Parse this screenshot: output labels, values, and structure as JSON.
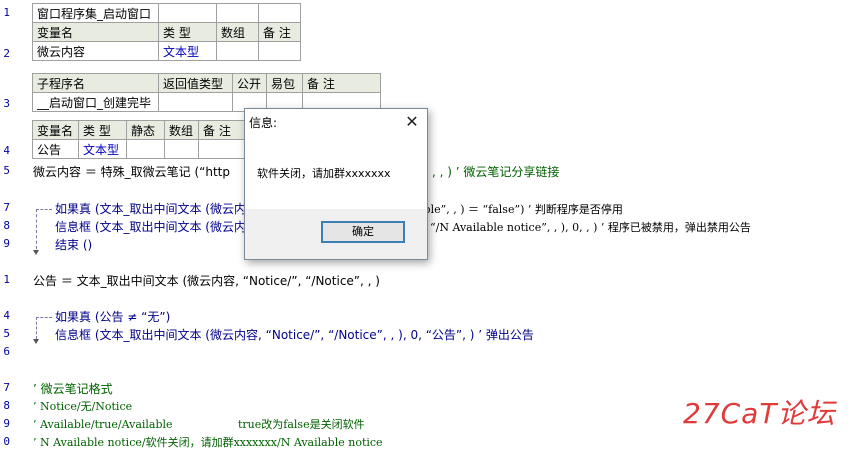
{
  "line_numbers": [
    "1",
    "2",
    "3",
    "4",
    "5",
    "7",
    "8",
    "9",
    "1",
    "4",
    "5",
    "6",
    "7",
    "8",
    "9",
    "0"
  ],
  "table1": {
    "title_row": [
      "窗口程序集_启动窗口",
      "",
      "",
      ""
    ],
    "header": [
      "变量名",
      "类 型",
      "数组",
      "备 注"
    ],
    "row": [
      "微云内容",
      "文本型",
      "",
      ""
    ]
  },
  "table2": {
    "header": [
      "子程序名",
      "返回值类型",
      "公开",
      "易包",
      "备 注"
    ],
    "row": [
      "__启动窗口_创建完毕",
      "",
      "",
      "",
      ""
    ]
  },
  "table3": {
    "header": [
      "变量名",
      "类 型",
      "静态",
      "数组",
      "备 注"
    ],
    "row": [
      "公告",
      "文本型",
      "",
      "",
      ""
    ]
  },
  "code": {
    "l5_a": "微云内容 ＝ 特殊_取微云笔记 (“http",
    "l5_b": ", , ) ’ 微云笔记分享链接",
    "l7_a": "如果真 (文本_取出中间文本 (微云内",
    "l7_b": "able”, , ) ＝ “false”) ’ 判断程序是否停用",
    "l8_a": "信息框 (文本_取出中间文本 (微云内",
    "l8_b": "“/N Available notice”, , ), 0, , ) ’ 程序已被禁用，弹出禁用公告",
    "l9": "结束 ()",
    "l11": "公告 ＝ 文本_取出中间文本 (微云内容, “Notice/”, “/Notice”, , )",
    "l13": "如果真 (公告 ≠ “无”)",
    "l14": "信息框 (文本_取出中间文本 (微云内容, “Notice/”, “/Notice”, , ), 0, “公告”, ) ’ 弹出公告",
    "c1": "’ 微云笔记格式",
    "c2": "’ Notice/无/Notice",
    "c3a": "’ Available/true/Available",
    "c3b": "true改为false是关闭软件",
    "c4": "’ N Available notice/软件关闭，请加群xxxxxxx/N Available notice"
  },
  "dialog": {
    "title": "信息:",
    "close": "✕",
    "message": "软件关闭，请加群xxxxxxx",
    "ok": "确定"
  },
  "watermark": "27CaT论坛"
}
